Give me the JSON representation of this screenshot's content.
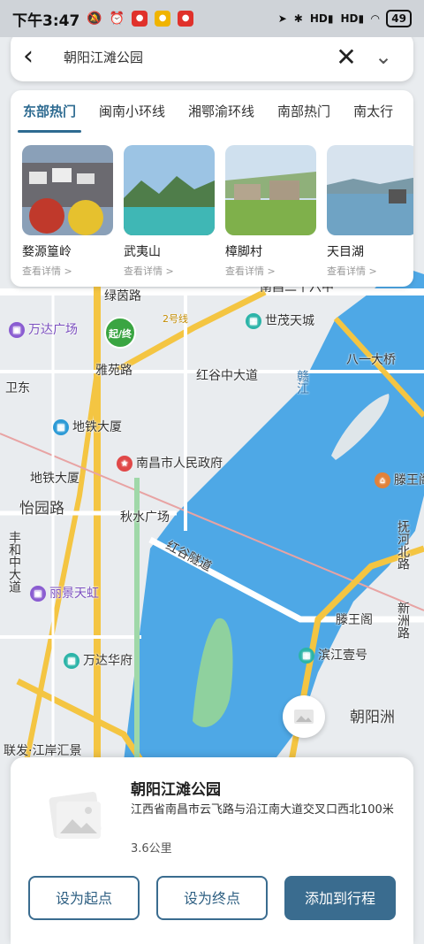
{
  "status_bar": {
    "time": "下午3:47",
    "battery": "49",
    "signal_labels": [
      "HD",
      "HD"
    ]
  },
  "search": {
    "query": "朝阳江滩公园",
    "back_icon": "chevron-left-icon",
    "close_icon": "close-icon",
    "collapse_icon": "chevron-down-icon"
  },
  "hot": {
    "tabs": [
      {
        "label": "东部热门",
        "active": true
      },
      {
        "label": "闽南小环线",
        "active": false
      },
      {
        "label": "湘鄂渝环线",
        "active": false
      },
      {
        "label": "南部热门",
        "active": false
      },
      {
        "label": "南太行",
        "active": false
      }
    ],
    "cards": [
      {
        "name": "婺源篁岭",
        "more": "查看详情 >"
      },
      {
        "name": "武夷山",
        "more": "查看详情 >"
      },
      {
        "name": "樟脚村",
        "more": "查看详情 >"
      },
      {
        "name": "天目湖",
        "more": "查看详情 >"
      }
    ]
  },
  "map": {
    "pin_label": "起/终",
    "labels": {
      "lvyinlu": "绿茵路",
      "wanda": "万达广场",
      "weidong": "卫东",
      "yazhou": "雅苑路",
      "ditie1": "地铁大厦",
      "ditie2": "地铁大厦",
      "gov": "南昌市人民政府",
      "yiyuanlu": "怡园路",
      "qiushui": "秋水广场",
      "fenghe": "丰和中大道",
      "lijing": "丽景天虹",
      "hongguzhong": "红谷中大道",
      "shimao": "世茂天城",
      "bayi": "八一大桥",
      "ganjiang": "赣江",
      "tengwang": "滕王阁",
      "tengwang2": "滕王阁",
      "honggusuidao": "红谷隧道",
      "wandahuafu": "万达华府",
      "binjiang": "滨江壹号",
      "chaoyangzhou": "朝阳洲",
      "lianfa": "联发·江岸汇景",
      "fuhebeilu": "抚河北路",
      "xinzhoulu": "新洲路",
      "nanchang2": "南昌二十六中",
      "road2": "2号线"
    }
  },
  "place": {
    "title": "朝阳江滩公园",
    "address": "江西省南昌市云飞路与沿江南大道交叉口西北100米",
    "distance": "3.6公里",
    "btn_start": "设为起点",
    "btn_end": "设为终点",
    "btn_add": "添加到行程"
  }
}
